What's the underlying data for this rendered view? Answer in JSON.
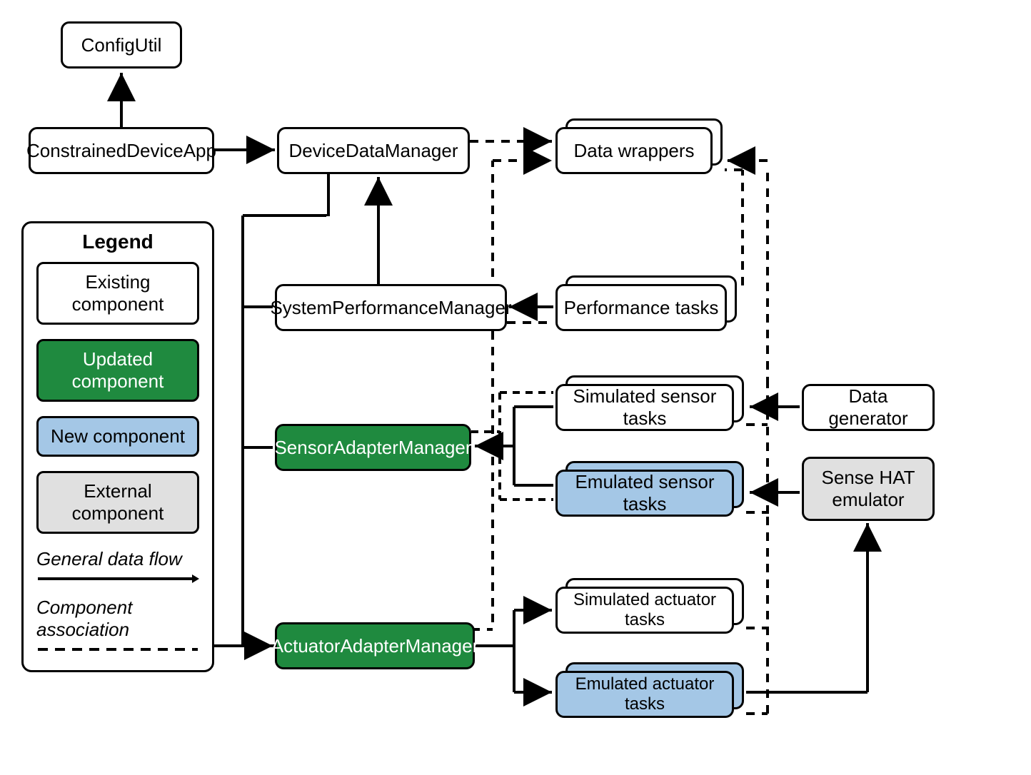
{
  "components": {
    "configUtil": "ConfigUtil",
    "constrainedDeviceApp": "ConstrainedDeviceApp",
    "deviceDataManager": "DeviceDataManager",
    "dataWrappers": "Data wrappers",
    "systemPerformanceManager": "SystemPerformanceManager",
    "performanceTasks": "Performance tasks",
    "sensorAdapterManager": "SensorAdapterManager",
    "simulatedSensorTasks": "Simulated sensor tasks",
    "emulatedSensorTasks": "Emulated sensor tasks",
    "dataGenerator": "Data generator",
    "senseHatEmulator": "Sense HAT emulator",
    "actuatorAdapterManager": "ActuatorAdapterManager",
    "simulatedActuatorTasks": "Simulated actuator tasks",
    "emulatedActuatorTasks": "Emulated actuator tasks"
  },
  "legend": {
    "title": "Legend",
    "existing": "Existing component",
    "updated": "Updated component",
    "new": "New component",
    "external": "External component",
    "generalFlow": "General data flow",
    "componentAssoc": "Component association"
  },
  "chart_data": {
    "type": "diagram",
    "nodes": [
      {
        "id": "ConfigUtil",
        "style": "existing"
      },
      {
        "id": "ConstrainedDeviceApp",
        "style": "existing"
      },
      {
        "id": "DeviceDataManager",
        "style": "existing"
      },
      {
        "id": "Data wrappers",
        "style": "existing",
        "stacked": true
      },
      {
        "id": "SystemPerformanceManager",
        "style": "existing"
      },
      {
        "id": "Performance tasks",
        "style": "existing",
        "stacked": true
      },
      {
        "id": "SensorAdapterManager",
        "style": "updated"
      },
      {
        "id": "Simulated sensor tasks",
        "style": "existing",
        "stacked": true
      },
      {
        "id": "Emulated sensor tasks",
        "style": "new",
        "stacked": true
      },
      {
        "id": "Data generator",
        "style": "existing"
      },
      {
        "id": "Sense HAT emulator",
        "style": "external"
      },
      {
        "id": "ActuatorAdapterManager",
        "style": "updated"
      },
      {
        "id": "Simulated actuator tasks",
        "style": "existing",
        "stacked": true
      },
      {
        "id": "Emulated actuator tasks",
        "style": "new",
        "stacked": true
      }
    ],
    "edges": [
      {
        "from": "ConstrainedDeviceApp",
        "to": "ConfigUtil",
        "type": "solid"
      },
      {
        "from": "ConstrainedDeviceApp",
        "to": "DeviceDataManager",
        "type": "solid"
      },
      {
        "from": "DeviceDataManager",
        "to": "Data wrappers",
        "type": "dashed"
      },
      {
        "from": "DeviceDataManager",
        "to": "SystemPerformanceManager",
        "type": "solid-down"
      },
      {
        "from": "SystemPerformanceManager",
        "to": "DeviceDataManager",
        "type": "solid-up"
      },
      {
        "from": "DeviceDataManager",
        "to": "SensorAdapterManager",
        "type": "solid-down"
      },
      {
        "from": "DeviceDataManager",
        "to": "ActuatorAdapterManager",
        "type": "solid-down"
      },
      {
        "from": "Performance tasks",
        "to": "SystemPerformanceManager",
        "type": "solid"
      },
      {
        "from": "SystemPerformanceManager",
        "to": "Performance tasks",
        "type": "dashed"
      },
      {
        "from": "Performance tasks",
        "to": "Data wrappers",
        "type": "dashed"
      },
      {
        "from": "Simulated sensor tasks",
        "to": "SensorAdapterManager",
        "type": "solid"
      },
      {
        "from": "Emulated sensor tasks",
        "to": "SensorAdapterManager",
        "type": "solid"
      },
      {
        "from": "SensorAdapterManager",
        "to": "Simulated sensor tasks",
        "type": "dashed"
      },
      {
        "from": "SensorAdapterManager",
        "to": "Emulated sensor tasks",
        "type": "dashed"
      },
      {
        "from": "Data generator",
        "to": "Simulated sensor tasks",
        "type": "solid"
      },
      {
        "from": "Sense HAT emulator",
        "to": "Emulated sensor tasks",
        "type": "solid"
      },
      {
        "from": "Simulated sensor tasks",
        "to": "Data wrappers",
        "type": "dashed"
      },
      {
        "from": "Emulated sensor tasks",
        "to": "Data wrappers",
        "type": "dashed"
      },
      {
        "from": "ActuatorAdapterManager",
        "to": "Simulated actuator tasks",
        "type": "solid"
      },
      {
        "from": "ActuatorAdapterManager",
        "to": "Emulated actuator tasks",
        "type": "solid"
      },
      {
        "from": "ActuatorAdapterManager",
        "to": "Data wrappers",
        "type": "dashed"
      },
      {
        "from": "Simulated actuator tasks",
        "to": "Data wrappers",
        "type": "dashed"
      },
      {
        "from": "Emulated actuator tasks",
        "to": "Data wrappers",
        "type": "dashed"
      },
      {
        "from": "Emulated actuator tasks",
        "to": "Sense HAT emulator",
        "type": "solid"
      }
    ],
    "legend_styles": {
      "existing": {
        "fill": "#ffffff",
        "label": "Existing component"
      },
      "updated": {
        "fill": "#1f8a3f",
        "label": "Updated component"
      },
      "new": {
        "fill": "#a4c7e6",
        "label": "New component"
      },
      "external": {
        "fill": "#e0e0e0",
        "label": "External component"
      }
    }
  }
}
